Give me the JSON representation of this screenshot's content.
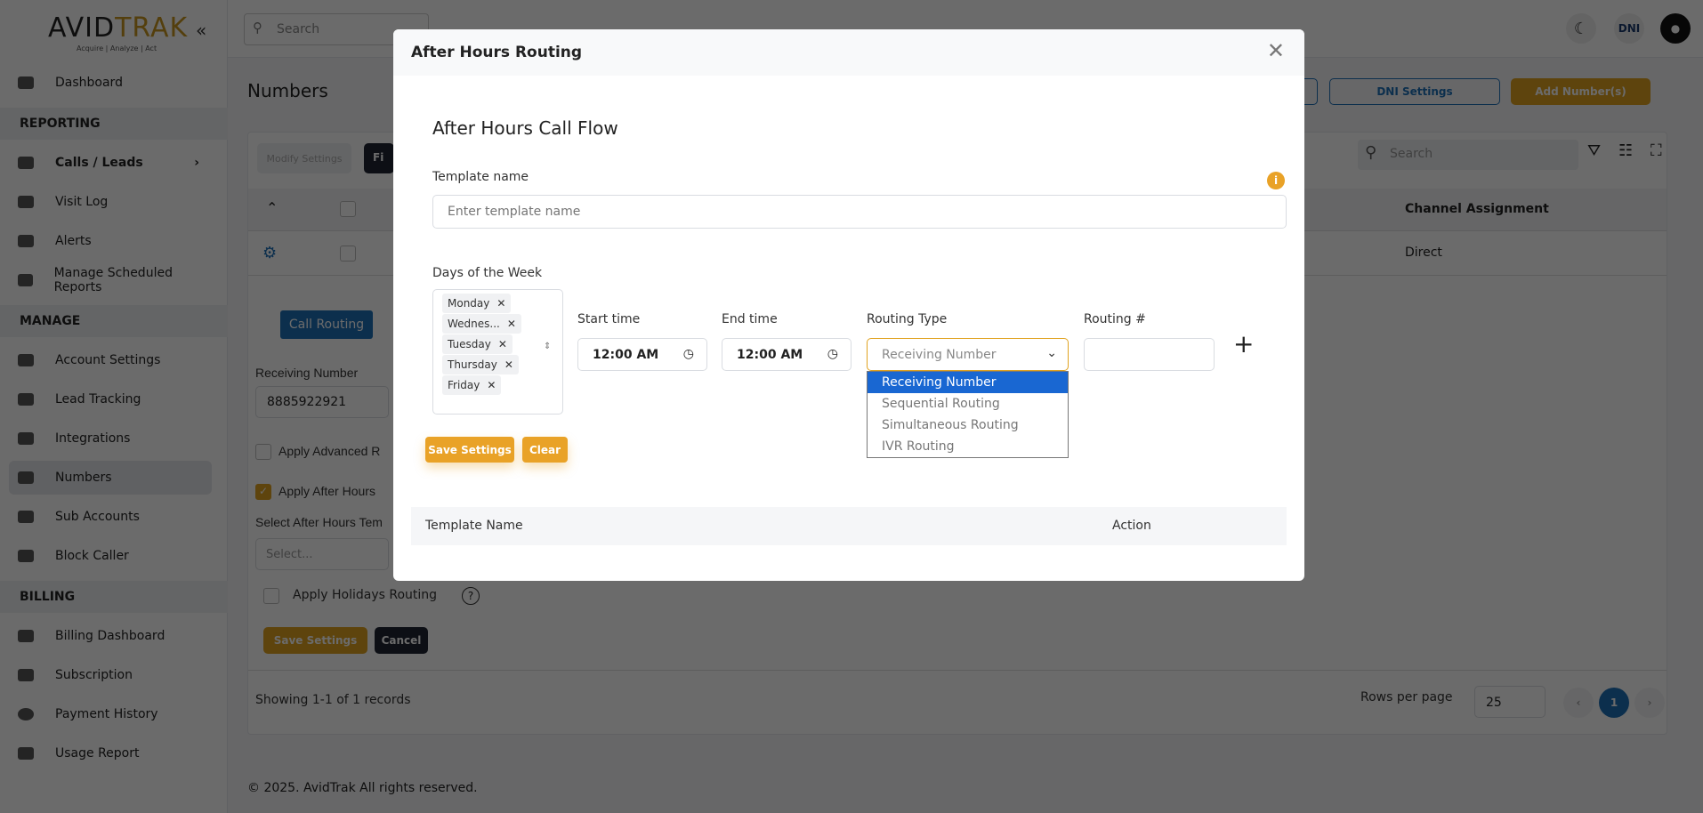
{
  "brand": {
    "logo_a": "AVID",
    "logo_b": "TRAK",
    "tagline": "Acquire | Analyze | Act"
  },
  "sidebar": {
    "dashboard": "Dashboard",
    "sections": [
      {
        "title": "REPORTING",
        "items": [
          "Calls / Leads",
          "Visit Log",
          "Alerts",
          "Manage Scheduled Reports"
        ]
      },
      {
        "title": "MANAGE",
        "items": [
          "Account Settings",
          "Lead Tracking",
          "Integrations",
          "Numbers",
          "Sub Accounts",
          "Block Caller"
        ]
      },
      {
        "title": "BILLING",
        "items": [
          "Billing Dashboard",
          "Subscription",
          "Payment History",
          "Usage Report"
        ]
      }
    ],
    "active": "Numbers"
  },
  "topbar": {
    "search_placeholder": "Search",
    "dni_badge": "DNI"
  },
  "page": {
    "title": "Numbers",
    "buttons": {
      "dni_settings": "DNI Settings",
      "add_numbers": "Add Number(s)"
    },
    "toolbar": {
      "modify": "Modify Settings",
      "filter": "Fi",
      "search_placeholder": "Search"
    },
    "table": {
      "column": "Channel Assignment",
      "cell": "Direct"
    },
    "details": {
      "call_routing": "Call Routing",
      "receiving_label": "Receiving Number",
      "receiving_value": "8885922921",
      "advanced": "Apply Advanced R",
      "after_hours": "Apply After Hours",
      "select_template_label": "Select After Hours Tem",
      "select_placeholder": "Select...",
      "holidays": "Apply Holidays Routing",
      "save": "Save Settings",
      "cancel": "Cancel"
    },
    "footer_records": "Showing 1-1 of 1 records",
    "rows_per_page_label": "Rows per page",
    "rows_per_page": "25",
    "current_page": "1",
    "copyright": "© 2025. AvidTrak All rights reserved."
  },
  "modal": {
    "title": "After Hours Routing",
    "heading": "After Hours Call Flow",
    "template_label": "Template name",
    "template_placeholder": "Enter template name",
    "days_label": "Days of the Week",
    "days": [
      "Monday",
      "Wednes...",
      "Tuesday",
      "Thursday",
      "Friday"
    ],
    "start_label": "Start time",
    "start_value": "12:00 AM",
    "end_label": "End time",
    "end_value": "12:00 AM",
    "routing_type_label": "Routing Type",
    "routing_type_value": "Receiving Number",
    "routing_options": [
      "Receiving Number",
      "Sequential Routing",
      "Simultaneous Routing",
      "IVR Routing"
    ],
    "routing_num_label": "Routing #",
    "save": "Save Settings",
    "clear": "Clear",
    "table_cols": [
      "Template Name",
      "Action"
    ]
  }
}
